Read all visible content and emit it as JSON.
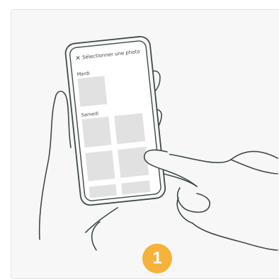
{
  "phone": {
    "title": "Sélectionner une photo",
    "close_icon": "close-icon",
    "sections": [
      {
        "label": "Mardi"
      },
      {
        "label": "Samedi"
      }
    ]
  },
  "step": {
    "number": "1"
  },
  "colors": {
    "card_bg": "#f7f7f7",
    "line": "#3f4b49",
    "thumb": "#e1e1e1",
    "badge": "#f6b23a"
  }
}
